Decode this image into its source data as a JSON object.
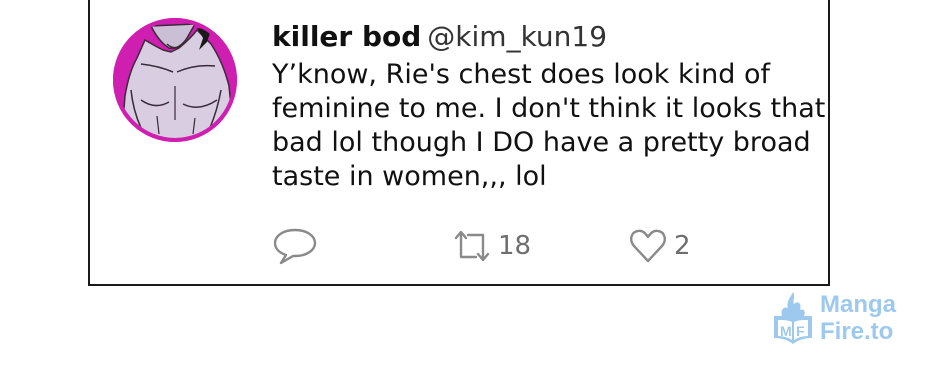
{
  "tweet": {
    "display_name": "killer bod",
    "handle": "@kim_kun19",
    "text_lines": [
      "Y’know, Rie's chest does look kind of",
      "feminine to me. I don't think it looks that",
      "bad lol though I DO have a pretty broad",
      "taste in women,,, lol"
    ],
    "actions": {
      "reply_icon": "speech-bubble-icon",
      "retweet_icon": "retweet-arrows-icon",
      "retweet_count": "18",
      "like_icon": "heart-icon",
      "like_count": "2"
    },
    "avatar": {
      "icon": "shirtless-man-drawing",
      "ring_color": "#cf1fb0"
    }
  },
  "watermark": {
    "line1": "Manga",
    "line2": "Fire.to",
    "logo_icon": "mangafire-flame-logo-icon",
    "color": "#9ec9ef"
  }
}
